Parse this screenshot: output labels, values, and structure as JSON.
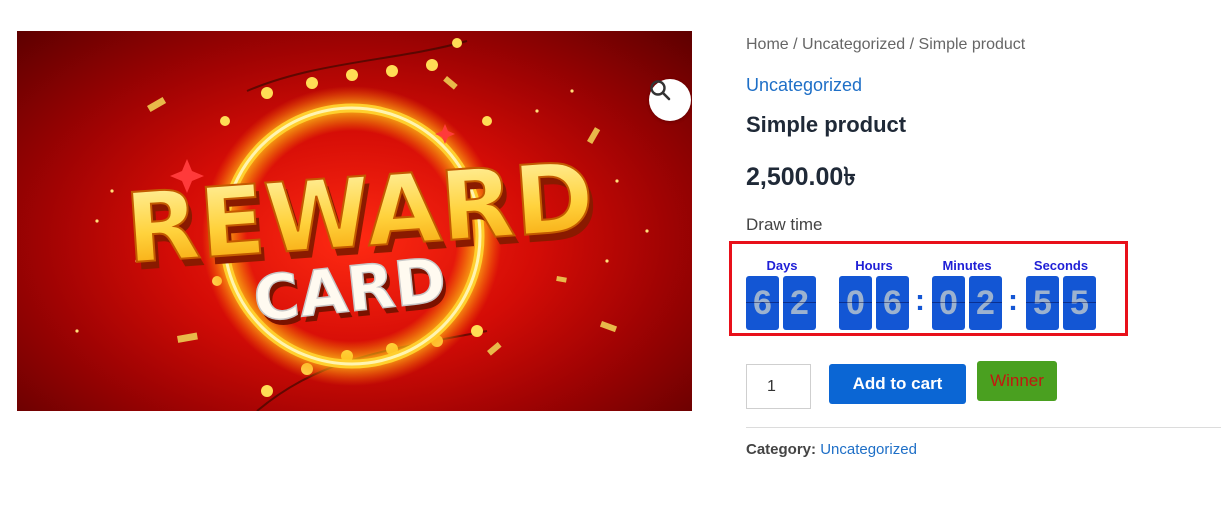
{
  "image": {
    "alt_text_line1": "REWARD",
    "alt_text_line2": "CARD",
    "zoom_icon": "magnifier-icon"
  },
  "breadcrumb": "Home / Uncategorized / Simple product",
  "category_link": "Uncategorized",
  "product": {
    "title": "Simple product",
    "price": "2,500.00৳"
  },
  "draw_time": {
    "label": "Draw time",
    "units": {
      "days": "Days",
      "hours": "Hours",
      "minutes": "Minutes",
      "seconds": "Seconds"
    },
    "digits": {
      "days": [
        "6",
        "2"
      ],
      "hours": [
        "0",
        "6"
      ],
      "minutes": [
        "0",
        "2"
      ],
      "seconds": [
        "5",
        "5"
      ]
    },
    "separator": ":"
  },
  "cart": {
    "quantity": "1",
    "add_label": "Add to cart",
    "winner_label": "Winner"
  },
  "meta": {
    "category_key": "Category:",
    "category_value": "Uncategorized"
  },
  "colors": {
    "link": "#1e6fc7",
    "button_primary": "#0b66d4",
    "winner_bg": "#4aa020",
    "winner_text": "#c21810",
    "countdown_border": "#e8101a",
    "digit_bg": "#1356d4"
  }
}
